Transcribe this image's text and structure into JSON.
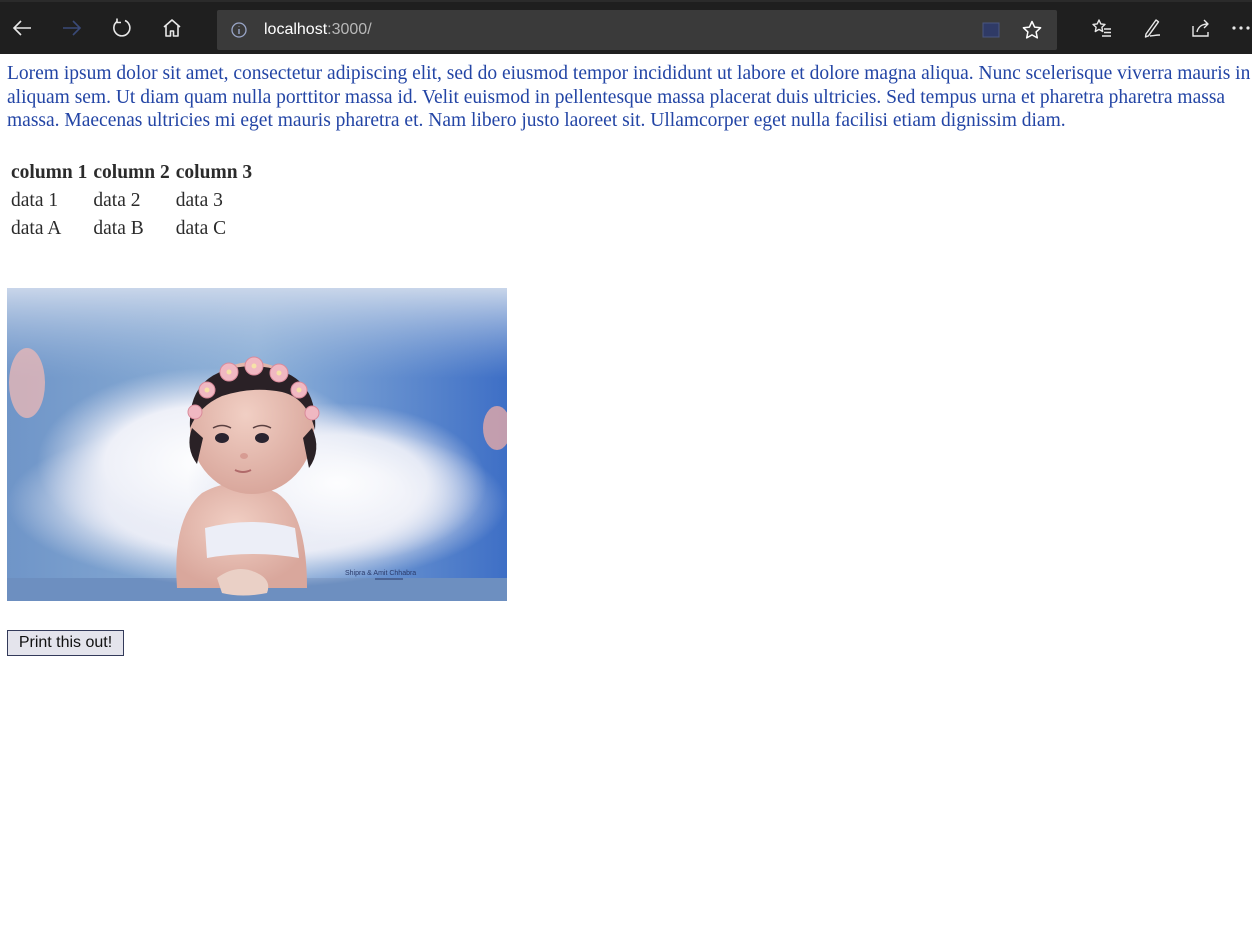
{
  "browser": {
    "url_host": "localhost",
    "url_rest": ":3000/"
  },
  "page": {
    "paragraph": "Lorem ipsum dolor sit amet, consectetur adipiscing elit, sed do eiusmod tempor incididunt ut labore et dolore magna aliqua. Nunc scelerisque viverra mauris in aliquam sem. Ut diam quam nulla porttitor massa id. Velit euismod in pellentesque massa placerat duis ultricies. Sed tempus urna et pharetra pharetra massa massa. Maecenas ultricies mi eget mauris pharetra et. Nam libero justo laoreet sit. Ullamcorper eget nulla facilisi etiam dignissim diam.",
    "table": {
      "headers": [
        "column 1",
        "column 2",
        "column 3"
      ],
      "rows": [
        [
          "data 1",
          "data 2",
          "data 3"
        ],
        [
          "data A",
          "data B",
          "data C"
        ]
      ]
    },
    "photo_watermark": "Shipra & Amit Chhabra",
    "print_button": "Print this out!"
  },
  "colors": {
    "toolbar": "#1f1f1f",
    "address_bar": "#3a3a3a",
    "paragraph_text": "#2345a5"
  }
}
